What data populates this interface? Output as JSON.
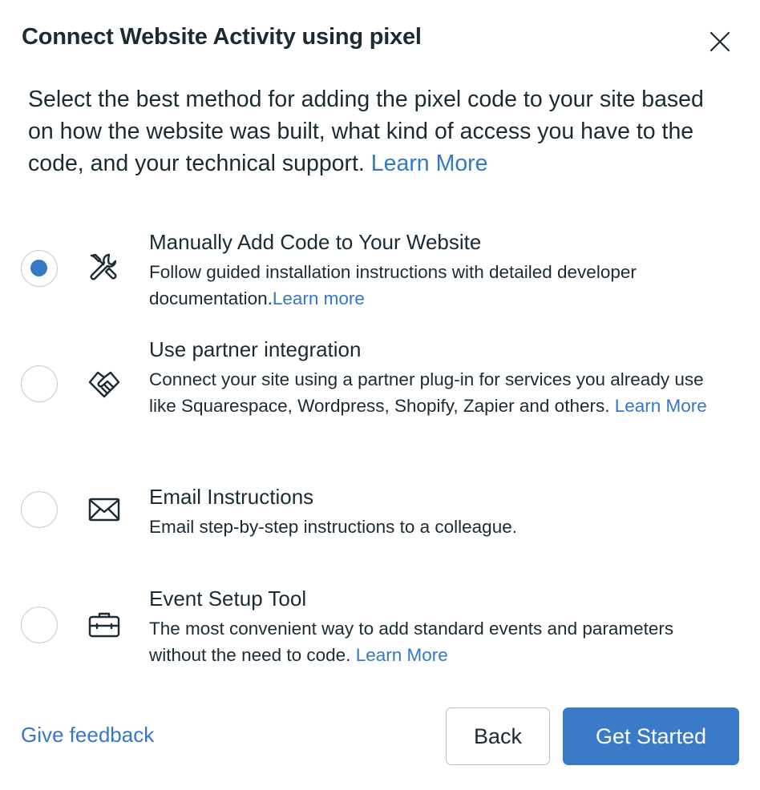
{
  "dialog": {
    "title": "Connect Website Activity using pixel",
    "close_icon": "close-icon",
    "intro_text": "Select the best method for adding the pixel code to your site based on how the website was built, what kind of access you have to the code, and your technical support. ",
    "intro_link": "Learn More"
  },
  "options": [
    {
      "title": "Manually Add Code to Your Website",
      "description": "Follow guided installation instructions with detailed developer documentation.",
      "link": "Learn more",
      "icon": "tools-icon",
      "selected": true
    },
    {
      "title": "Use partner integration",
      "description": "Connect your site using a partner plug-in for services you already use like Squarespace, Wordpress, Shopify, Zapier and others. ",
      "link": "Learn More",
      "icon": "handshake-icon",
      "selected": false
    },
    {
      "title": "Email Instructions",
      "description": "Email step-by-step instructions to a colleague.",
      "icon": "envelope-icon",
      "selected": false
    },
    {
      "title": "Event Setup Tool",
      "description": "The most convenient way to add standard events and parameters without the need to code. ",
      "link": "Learn More",
      "icon": "toolbox-icon",
      "selected": false
    }
  ],
  "footer": {
    "feedback_label": "Give feedback",
    "back_label": "Back",
    "start_label": "Get Started"
  },
  "colors": {
    "accent": "#3578c5",
    "primary_button": "#3a7bc8",
    "text": "#1c2b33"
  }
}
